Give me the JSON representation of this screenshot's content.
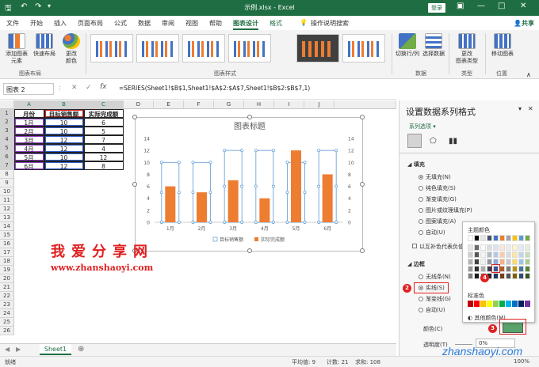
{
  "titlebar": {
    "title": "示例.xlsx - Excel",
    "login": "登录",
    "qat_icons": [
      "save-icon",
      "undo-icon",
      "redo-icon"
    ]
  },
  "tabs": [
    "文件",
    "开始",
    "插入",
    "页面布局",
    "公式",
    "数据",
    "审阅",
    "视图",
    "帮助",
    "图表设计",
    "格式"
  ],
  "active_tab": "图表设计",
  "search_label": "操作说明搜索",
  "share_label": "共享",
  "ribbon": {
    "add_element": "添加图表\n元素",
    "quick_layout": "快速布局",
    "change_color": "更改\n颜色",
    "group_layout": "图表布局",
    "group_styles": "图表样式",
    "switch_rowcol": "切换行/列",
    "select_data": "选择数据",
    "group_data": "数据",
    "change_type": "更改\n图表类型",
    "group_type": "类型",
    "move_chart": "移动图表",
    "group_location": "位置"
  },
  "formula_bar": {
    "name_box": "图表 2",
    "formula": "=SERIES(Sheet1!$B$1,Sheet1!$A$2:$A$7,Sheet1!$B$2:$B$7,1)"
  },
  "columns": [
    "A",
    "B",
    "C",
    "D",
    "E",
    "F",
    "G",
    "H",
    "I",
    "J"
  ],
  "rows": [
    "1",
    "2",
    "3",
    "4",
    "5",
    "6",
    "7",
    "8",
    "9",
    "10",
    "11",
    "12",
    "13",
    "14",
    "15",
    "16",
    "17",
    "18",
    "19",
    "20",
    "21",
    "22",
    "23",
    "24",
    "25",
    "26"
  ],
  "table": {
    "headers": [
      "月份",
      "目标销售额",
      "实际完成额"
    ],
    "rows": [
      [
        "1月",
        "10",
        "6"
      ],
      [
        "2月",
        "10",
        "5"
      ],
      [
        "3月",
        "12",
        "7"
      ],
      [
        "4月",
        "12",
        "4"
      ],
      [
        "5月",
        "10",
        "12"
      ],
      [
        "6月",
        "12",
        "8"
      ]
    ]
  },
  "chart_data": {
    "type": "bar",
    "title": "图表标题",
    "categories": [
      "1月",
      "2月",
      "3月",
      "4月",
      "5月",
      "6月"
    ],
    "series": [
      {
        "name": "目标销售额",
        "values": [
          10,
          10,
          12,
          12,
          10,
          12
        ],
        "color": "#ffffff",
        "border": "#5b9bd5"
      },
      {
        "name": "实际完成额",
        "values": [
          6,
          5,
          7,
          4,
          12,
          8
        ],
        "color": "#ed7d31"
      }
    ],
    "ylim": [
      0,
      14
    ],
    "yticks": [
      "0",
      "2",
      "4",
      "6",
      "8",
      "10",
      "12",
      "14"
    ],
    "y2ticks": [
      "0",
      "2",
      "4",
      "6",
      "8",
      "10",
      "12",
      "14"
    ],
    "legend": "bottom",
    "grid": false
  },
  "watermark": {
    "cn": "我爱分享网",
    "url": "www.zhanshaoyi.com",
    "bottom": "zhanshaoyi.com"
  },
  "sheet_tab": "Sheet1",
  "status": {
    "ready": "就绪",
    "avg": "平均值: 9",
    "count": "计数: 21",
    "sum": "求和: 108",
    "zoom": "100%"
  },
  "pane": {
    "title": "设置数据系列格式",
    "series_options": "系列选项",
    "fill_header": "填充",
    "fill_options": [
      "无填充(N)",
      "纯色填充(S)",
      "渐变填充(G)",
      "图片或纹理填充(P)",
      "图案填充(A)",
      "自动(U)"
    ],
    "invert": "以互补色代表负值",
    "border_header": "边框",
    "border_options": [
      "无线条(N)",
      "实线(S)",
      "渐变线(G)",
      "自动(U)"
    ],
    "color_label": "颜色(C)",
    "transparency_label": "透明度(T)",
    "transparency_value": "0%"
  },
  "color_popup": {
    "theme_label": "主题颜色",
    "standard_label": "标准色",
    "more_label": "其他颜色(M)...",
    "theme_top": [
      "#ffffff",
      "#000000",
      "#e7e6e6",
      "#44546a",
      "#4472c4",
      "#ed7d31",
      "#a5a5a5",
      "#ffc000",
      "#5b9bd5",
      "#70ad47"
    ],
    "standard": [
      "#c00000",
      "#ff0000",
      "#ffc000",
      "#ffff00",
      "#92d050",
      "#00b050",
      "#00b0f0",
      "#0070c0",
      "#002060",
      "#7030a0"
    ]
  },
  "callouts": [
    "2",
    "3",
    "4"
  ]
}
